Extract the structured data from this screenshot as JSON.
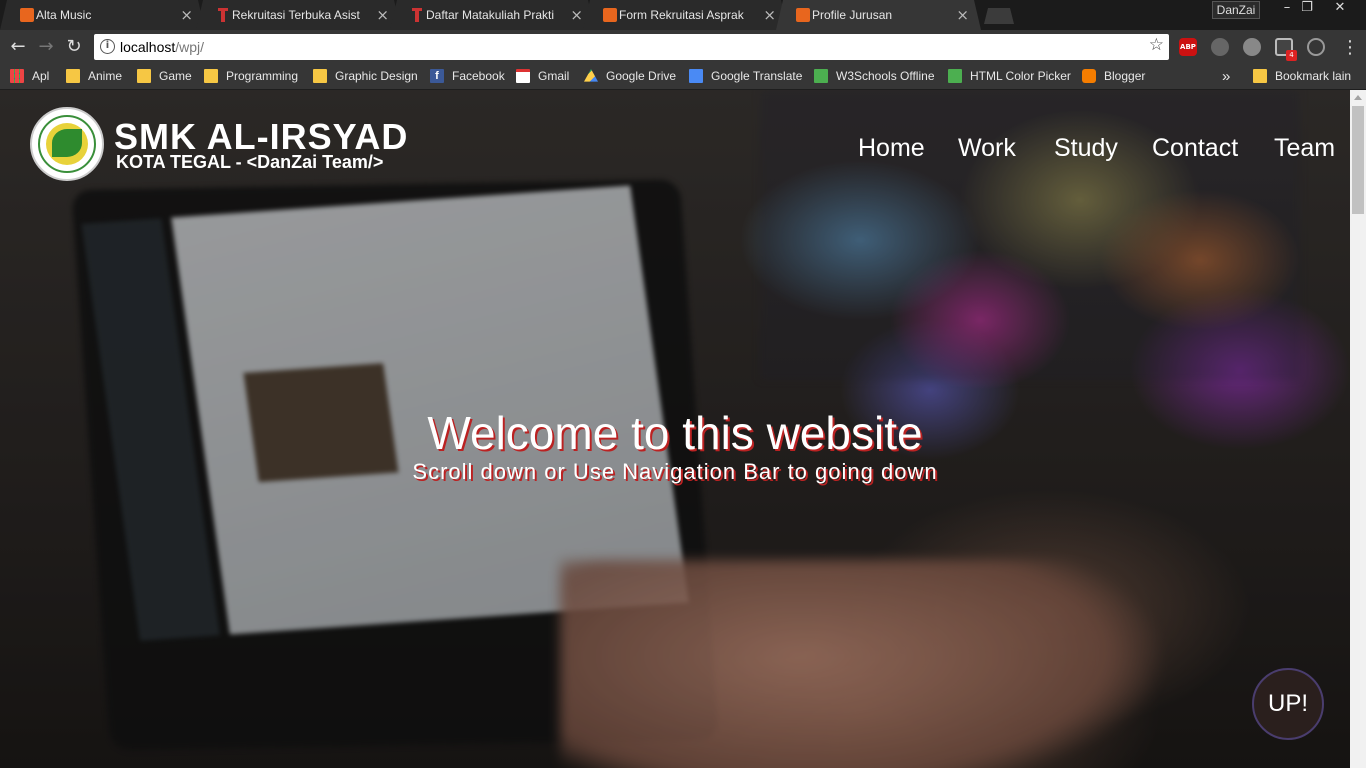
{
  "tabs": [
    {
      "title": "Alta Music",
      "icon": "xampp-icon",
      "active": false
    },
    {
      "title": "Rekruitasi Terbuka Asisten",
      "icon": "pin-icon",
      "active": false
    },
    {
      "title": "Daftar Matakuliah Praktikum",
      "icon": "pin-icon",
      "active": false
    },
    {
      "title": "Form Rekruitasi Asprak F",
      "icon": "xampp-icon",
      "active": false
    },
    {
      "title": "Profile Jurusan",
      "icon": "xampp-icon",
      "active": true
    }
  ],
  "tab_close_glyph": "×",
  "profile_name": "DanZai",
  "window_controls": {
    "minimize": "–",
    "restore": "❐",
    "close": "✕"
  },
  "address": {
    "host": "localhost",
    "path": "/wpj/"
  },
  "bookmarks": [
    {
      "label": "Apl",
      "icon": "apps-grid-icon"
    },
    {
      "label": "Anime",
      "icon": "folder-icon"
    },
    {
      "label": "Game",
      "icon": "folder-icon"
    },
    {
      "label": "Programming",
      "icon": "folder-icon"
    },
    {
      "label": "Graphic Design",
      "icon": "folder-icon"
    },
    {
      "label": "Facebook",
      "icon": "facebook-icon"
    },
    {
      "label": "Gmail",
      "icon": "gmail-icon"
    },
    {
      "label": "Google Drive",
      "icon": "drive-icon"
    },
    {
      "label": "Google Translate",
      "icon": "translate-icon"
    },
    {
      "label": "W3Schools Offline",
      "icon": "w3schools-icon"
    },
    {
      "label": "HTML Color Picker",
      "icon": "w3schools-icon"
    },
    {
      "label": "Blogger",
      "icon": "blogger-icon"
    }
  ],
  "bookmarks_overflow": "»",
  "other_bookmarks": "Bookmark lain",
  "extensions": {
    "abp_label": "ABP",
    "badge": "4"
  },
  "site": {
    "brand_line1": "SMK AL-IRSYAD",
    "brand_line2": "KOTA TEGAL  -  <DanZai Team/>",
    "nav": [
      "Home",
      "Work",
      "Study",
      "Contact",
      "Team"
    ],
    "hero_title": "Welcome to this website",
    "hero_subtitle": "Scroll down or Use Navigation Bar to going down",
    "up_button": "UP!"
  },
  "colors": {
    "accent_shadow": "#b22222",
    "tab_active": "#363636",
    "toolbar": "#363636"
  }
}
